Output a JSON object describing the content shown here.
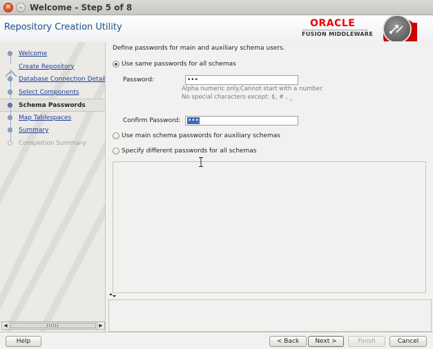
{
  "window": {
    "title": "Welcome - Step 5 of 8",
    "close_glyph": "✕",
    "minimize_glyph": "–"
  },
  "header": {
    "app_title": "Repository Creation Utility",
    "brand": "ORACLE",
    "brand_sub": "FUSION MIDDLEWARE",
    "brand_color": "#e00000"
  },
  "sidebar": {
    "items": [
      {
        "label": "Welcome",
        "state": "done"
      },
      {
        "label": "Create Repository",
        "state": "done"
      },
      {
        "label": "Database Connection Details",
        "state": "done"
      },
      {
        "label": "Select Components",
        "state": "done"
      },
      {
        "label": "Schema Passwords",
        "state": "current"
      },
      {
        "label": "Map Tablespaces",
        "state": "done"
      },
      {
        "label": "Summary",
        "state": "done"
      },
      {
        "label": "Completion Summary",
        "state": "pending"
      }
    ],
    "scroll_left": "◀",
    "scroll_right": "▶"
  },
  "main": {
    "intro": "Define passwords for main and auxiliary schema users.",
    "options": [
      {
        "label": "Use same passwords for all schemas",
        "selected": true
      },
      {
        "label": "Use main schema passwords for auxiliary schemas",
        "selected": false
      },
      {
        "label": "Specify different passwords for all schemas",
        "selected": false
      }
    ],
    "password_label": "Password:",
    "password_value": "•••",
    "hint_line1": "Alpha numeric only.Cannot start with a number.",
    "hint_line2": "No special characters except: $, # , _",
    "confirm_label": "Confirm Password:",
    "confirm_value": "•••"
  },
  "buttons": {
    "help": "Help",
    "back": "< Back",
    "next": "Next >",
    "finish": "Finish",
    "cancel": "Cancel"
  },
  "colors": {
    "link": "#1a3d99",
    "title": "#1b4f8a",
    "selection": "#3d6bb8"
  }
}
